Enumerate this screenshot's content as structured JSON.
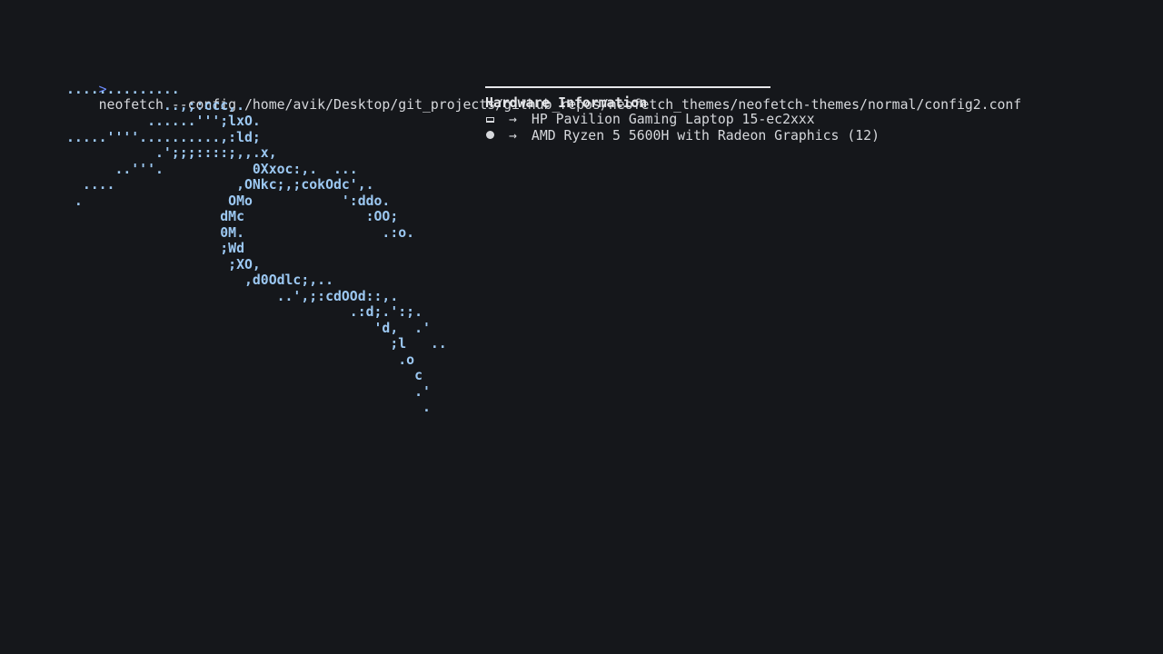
{
  "terminal": {
    "prompt_symbol": ">",
    "command": "neofetch --config /home/avik/Desktop/git_projects/github_repos/neofetch_themes/neofetch-themes/normal/config2.conf",
    "ascii_art": "..............\n            ..,;:ccc,.\n          ......''';lxO.\n.....''''..........,:ld;\n           .';;;::::;,,.x,\n      ..'''.           0Xxoc:,.  ...\n  ....               ,ONkc;,;cokOdc',.\n .                  OMo           ':ddo.\n                   dMc               :OO;\n                   0M.                 .:o.\n                   ;Wd\n                    ;XO,\n                      ,d0Odlc;,..\n                          ..',;:cdOOd::,.\n                                   .:d;.':;.\n                                      'd,  .'\n                                        ;l   ..\n                                         .o\n                                           c\n                                           .'\n                                            ."
  },
  "info": {
    "title": "Hardware Information",
    "arrow": "→",
    "rows": [
      {
        "icon": "laptop-icon",
        "value": "HP Pavilion Gaming Laptop 15-ec2xxx"
      },
      {
        "icon": "cpu-icon",
        "value": "AMD Ryzen 5 5600H with Radeon Graphics (12)"
      }
    ]
  }
}
